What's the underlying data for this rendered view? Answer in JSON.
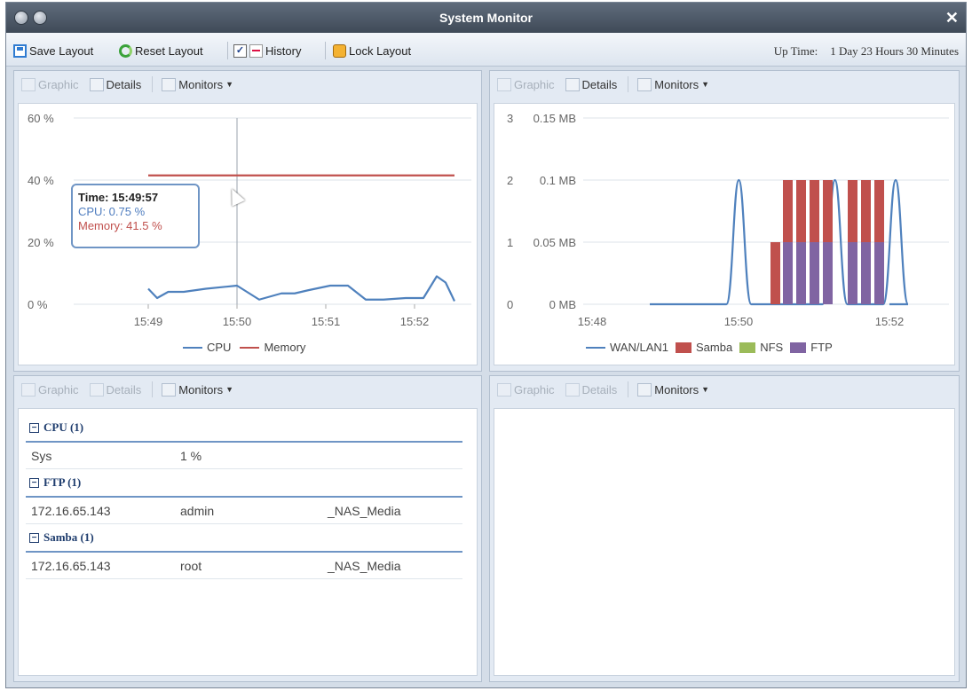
{
  "window": {
    "title": "System Monitor"
  },
  "toolbar": {
    "save_layout": "Save Layout",
    "reset_layout": "Reset Layout",
    "history": "History",
    "lock_layout": "Lock Layout",
    "uptime_label": "Up Time:",
    "uptime_value": "1 Day 23 Hours 30 Minutes"
  },
  "panels": [
    {
      "graphic": "Graphic",
      "details": "Details",
      "monitors": "Monitors"
    },
    {
      "graphic": "Graphic",
      "details": "Details",
      "monitors": "Monitors"
    },
    {
      "graphic": "Graphic",
      "details": "Details",
      "monitors": "Monitors"
    },
    {
      "graphic": "Graphic",
      "details": "Details",
      "monitors": "Monitors"
    }
  ],
  "tooltip": {
    "time": "Time: 15:49:57",
    "cpu": "CPU: 0.75 %",
    "memory": "Memory: 41.5 %"
  },
  "colors": {
    "cpu": "#4f81bd",
    "memory": "#c0504d",
    "samba": "#c0504d",
    "nfs": "#9bbb59",
    "ftp": "#8064a2",
    "wan": "#4f81bd"
  },
  "chart_data": [
    {
      "type": "line",
      "y_ticks": [
        "60 %",
        "40 %",
        "20 %",
        "0 %"
      ],
      "ylim": [
        0,
        60
      ],
      "x_ticks": [
        "15:49",
        "15:50",
        "15:51",
        "15:52"
      ],
      "series": [
        {
          "name": "CPU",
          "x": [
            15.0,
            15.2,
            15.45,
            15.8,
            16.3,
            17.0,
            17.5,
            18.0,
            18.3,
            18.6,
            19.1,
            19.5,
            19.9,
            20.3,
            20.8,
            21.2,
            21.5,
            21.7,
            21.9
          ],
          "y": [
            5,
            2,
            4,
            4,
            5,
            6,
            1.5,
            3.5,
            3.5,
            4.5,
            6,
            6,
            1.5,
            1.5,
            2,
            2,
            9,
            7,
            1
          ]
        },
        {
          "name": "Memory",
          "x": [
            15.0,
            21.9
          ],
          "y": [
            41.5,
            41.5
          ]
        }
      ]
    },
    {
      "type": "bar",
      "y_ticks_left": [
        "3",
        "2",
        "1",
        "0"
      ],
      "y_ticks_right": [
        "0.15 MB",
        "0.1 MB",
        "0.05 MB",
        "0 MB"
      ],
      "ylim": [
        0,
        3
      ],
      "x_ticks": [
        "15:48",
        "15:50",
        "15:52"
      ],
      "series": [
        {
          "name": "WAN/LAN1",
          "kind": "line",
          "peaks": [
            17.9,
            19.8,
            21.0
          ]
        },
        {
          "name": "Samba",
          "kind": "bar",
          "stack": [
            1,
            1,
            1,
            1,
            1,
            1,
            1,
            1
          ]
        },
        {
          "name": "NFS",
          "kind": "bar",
          "stack": [
            0,
            0,
            0,
            0,
            0,
            0,
            0,
            0
          ]
        },
        {
          "name": "FTP",
          "kind": "bar",
          "stack": [
            0,
            1,
            1,
            1,
            1,
            1,
            1,
            1
          ]
        }
      ]
    }
  ],
  "details": {
    "groups": [
      {
        "title": "CPU (1)",
        "rows": [
          [
            "Sys",
            "1 %",
            ""
          ]
        ]
      },
      {
        "title": "FTP (1)",
        "rows": [
          [
            "172.16.65.143",
            "admin",
            "_NAS_Media"
          ]
        ]
      },
      {
        "title": "Samba (1)",
        "rows": [
          [
            "172.16.65.143",
            "root",
            "_NAS_Media"
          ]
        ]
      }
    ]
  }
}
